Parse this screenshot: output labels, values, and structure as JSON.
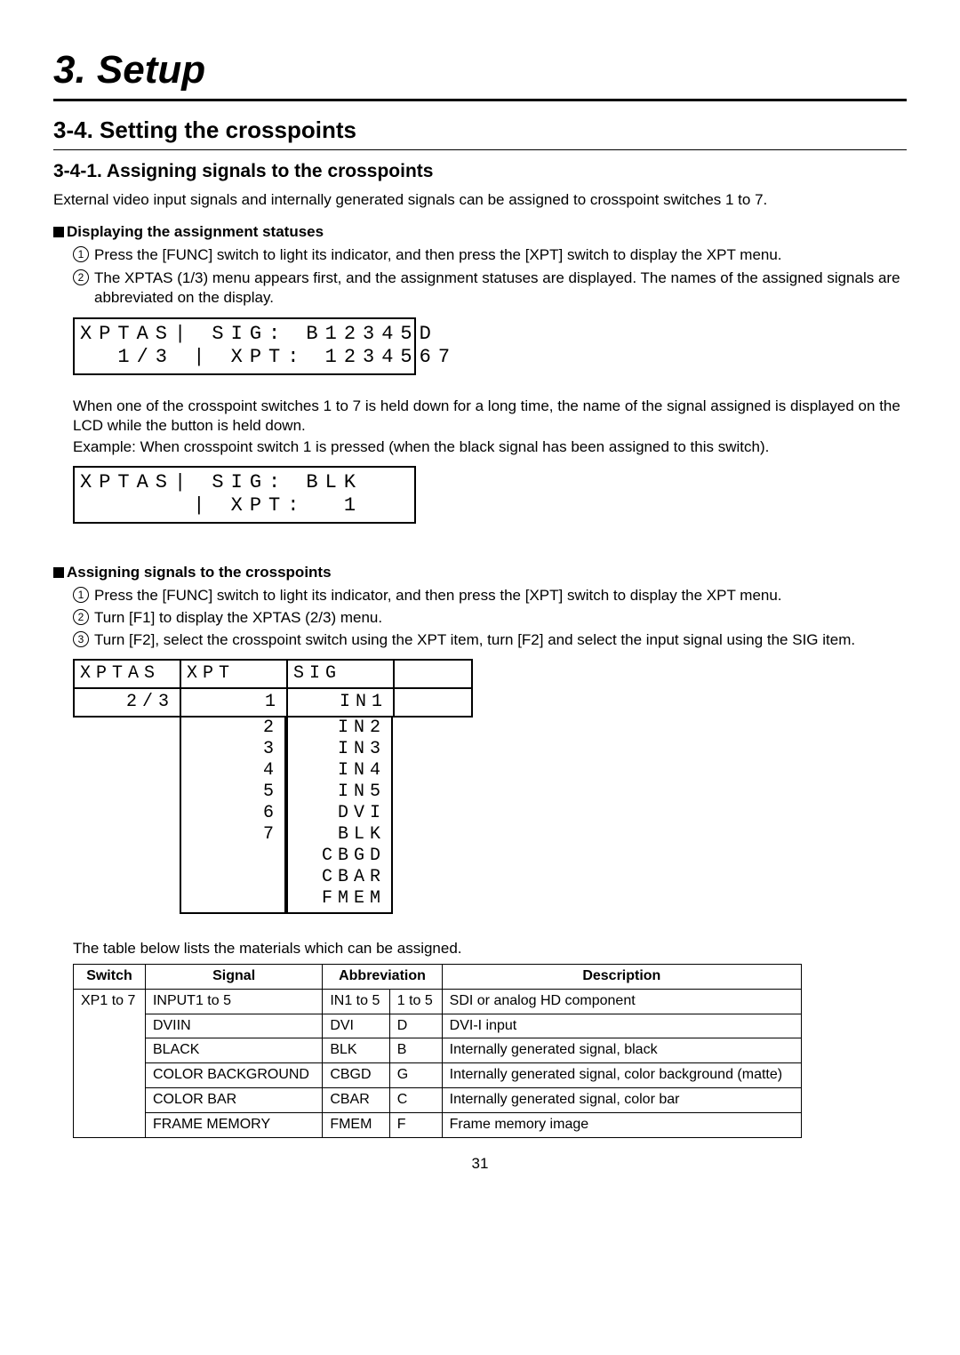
{
  "chapter": "3. Setup",
  "section_title": "3-4. Setting the crosspoints",
  "subsection_title": "3-4-1. Assigning signals to the crosspoints",
  "intro": "External video input signals and internally generated signals can be assigned to crosspoint switches 1 to 7.",
  "block_display_title": "Displaying the assignment statuses",
  "display_steps": {
    "s1": "Press the [FUNC] switch to light its indicator, and then press the [XPT] switch to display the XPT menu.",
    "s2": "The XPTAS (1/3) menu appears first, and the assignment statuses are displayed. The names of the assigned signals are abbreviated on the display."
  },
  "lcd1": "XPTAS| SIG: B12345D\n  1/3 | XPT: 1234567",
  "held_note": "When one of the crosspoint switches 1 to 7 is held down for a long time, the name of the signal assigned is displayed on the LCD while the button is held down.",
  "held_example": "Example: When crosspoint switch 1 is pressed (when the black signal has been assigned to this switch).",
  "lcd2": "XPTAS| SIG: BLK\n      | XPT:  1",
  "block_assign_title": "Assigning signals to the crosspoints",
  "assign_steps": {
    "s1": "Press the [FUNC] switch to light its indicator, and then press the [XPT] switch to display the XPT menu.",
    "s2": "Turn [F1] to display the XPTAS (2/3) menu.",
    "s3": "Turn [F2], select the crosspoint switch using the XPT item, turn [F2] and select the input signal using the SIG item."
  },
  "menu3": {
    "c1l1": "XPTAS",
    "c1l2": "  2/3",
    "c2l1": "XPT  ",
    "c2l2": "1",
    "c3l1": "SIG  ",
    "c3l2": "IN1",
    "c4l1": " ",
    "c4l2": " "
  },
  "xpt_options": "2\n3\n4\n5\n6\n7",
  "sig_options": "IN2\nIN3\nIN4\nIN5\nDVI\nBLK\nCBGD\nCBAR\nFMEM",
  "table_caption": "The table below lists the materials which can be assigned.",
  "table": {
    "headers": {
      "h1": "Switch",
      "h2": "Signal",
      "h3": "Abbreviation",
      "h4": "Description"
    },
    "switch_cell": "XP1 to 7",
    "rows": [
      {
        "signal": "INPUT1 to 5",
        "abbr": "IN1 to 5",
        "code": "1 to 5",
        "desc": "SDI or analog HD component"
      },
      {
        "signal": "DVIIN",
        "abbr": "DVI",
        "code": "D",
        "desc": "DVI-I input"
      },
      {
        "signal": "BLACK",
        "abbr": "BLK",
        "code": "B",
        "desc": "Internally generated signal, black"
      },
      {
        "signal": "COLOR BACKGROUND",
        "abbr": "CBGD",
        "code": "G",
        "desc": "Internally generated signal, color background (matte)"
      },
      {
        "signal": "COLOR BAR",
        "abbr": "CBAR",
        "code": "C",
        "desc": "Internally generated signal, color bar"
      },
      {
        "signal": "FRAME MEMORY",
        "abbr": "FMEM",
        "code": "F",
        "desc": "Frame memory image"
      }
    ]
  },
  "page_number": "31"
}
